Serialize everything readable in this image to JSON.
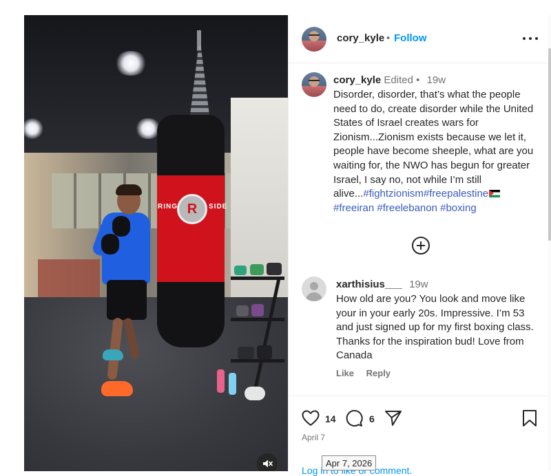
{
  "post": {
    "author": "cory_kyle",
    "follow_separator": "•",
    "follow_label": "Follow",
    "more_icon": "more-horizontal-icon"
  },
  "caption": {
    "username": "cory_kyle",
    "edited_label": "Edited",
    "separator": "•",
    "time": "19w",
    "text": "Disorder, disorder, that’s what the people need to do, create disorder while the United States of Israel creates wars for Zionism...Zionism exists because we let it, people have become sheeple, what are you waiting for, the NWO has begun for greater Israel, I say no, not while I’m still alive...",
    "hashtags_line1": [
      "#fightzionism",
      "#freepalestine"
    ],
    "flag_icon": "palestine-flag-emoji",
    "hashtags_line2": [
      "#freeiran",
      "#freelebanon",
      "#boxing"
    ]
  },
  "load_more_icon": "plus-circle-icon",
  "comment": {
    "username": "xarthisius___",
    "time": "19w",
    "text": "How old are you? You look and move like your in your early 20s. Impressive. I’m 53 and just signed up for my first boxing class. Thanks for the inspiration bud! Love from Canada",
    "like_label": "Like",
    "reply_label": "Reply"
  },
  "actions": {
    "like_count": "14",
    "comment_count": "6",
    "like_icon": "heart-icon",
    "comment_icon": "comment-bubble-icon",
    "share_icon": "paper-plane-icon",
    "save_icon": "bookmark-icon"
  },
  "date_label": "April 7",
  "footer_text": "Log in to like or comment.",
  "tooltip": "Apr 7, 2026",
  "video": {
    "mute_icon": "speaker-muted-icon",
    "bag_brand_left": "RING",
    "bag_brand_mark": "R",
    "bag_brand_right": "SIDE"
  },
  "colors": {
    "accent_blue": "#0095f6",
    "hashtag_blue": "#3b5bc0",
    "secondary_text": "#737373",
    "bag_red": "#d0121c"
  }
}
